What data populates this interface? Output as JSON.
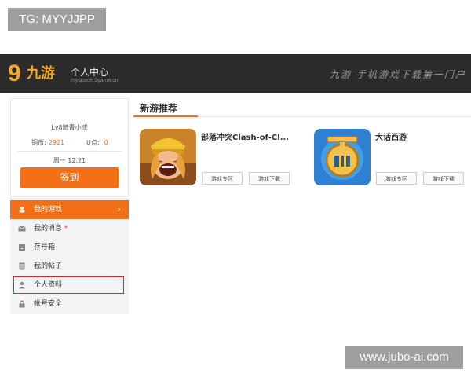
{
  "watermark_top": "TG: MYYJJPP",
  "watermark_bottom": "www.jubo-ai.com",
  "header": {
    "logo_text": "九游",
    "title": "个人中心",
    "url": "myspace.9game.cn",
    "slogan": "九游 手机游戏下载第一门户"
  },
  "profile": {
    "level": "Lv8畸青小成",
    "coin_label": "铜币:",
    "coin_value": "2921",
    "u_label": "U点:",
    "u_value": "0",
    "date": "周一 12.21",
    "signin_label": "签到"
  },
  "menu": [
    {
      "label": "我的游戏",
      "icon": "game-icon"
    },
    {
      "label": "我的消息",
      "icon": "mail-icon",
      "badge": "*"
    },
    {
      "label": "存号箱",
      "icon": "storage-icon"
    },
    {
      "label": "我的帖子",
      "icon": "post-icon"
    },
    {
      "label": "个人资料",
      "icon": "user-icon"
    },
    {
      "label": "帐号安全",
      "icon": "lock-icon"
    }
  ],
  "section_title": "新游推荐",
  "games": [
    {
      "name": "部落冲突Clash-of-Cl...",
      "btn_zone": "游戏专区",
      "btn_download": "游戏下载",
      "icon": "clash-of-clans-icon"
    },
    {
      "name": "大话西游",
      "btn_zone": "游戏专区",
      "btn_download": "游戏下载",
      "icon": "dahua-xiyou-icon"
    }
  ],
  "colors": {
    "accent": "#f37016",
    "header_bg": "#2b2b2b",
    "highlight_box": "#d9262c"
  }
}
